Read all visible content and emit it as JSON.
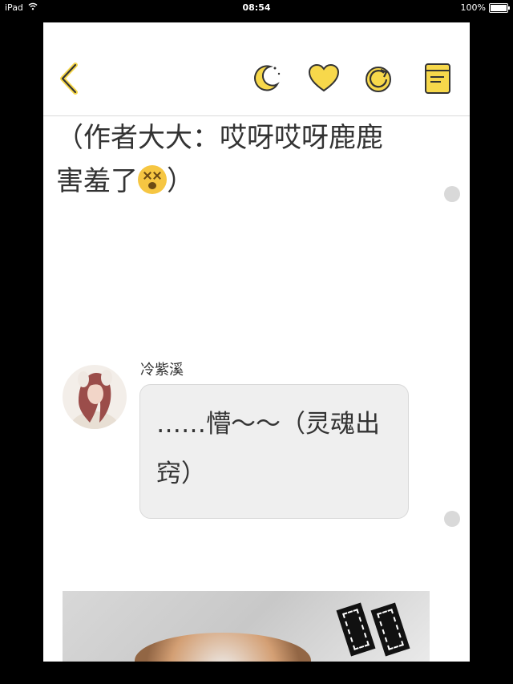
{
  "status_bar": {
    "device": "iPad",
    "time": "08:54",
    "battery": "100%"
  },
  "toolbar": {
    "back_icon": "chevron-left-icon",
    "night_mode_icon": "moon-icon",
    "favorite_icon": "heart-icon",
    "refresh_icon": "refresh-icon",
    "contents_icon": "book-icon",
    "accent_color": "#f7d84b"
  },
  "story": {
    "narration": "（作者大大：哎呀哎呀鹿鹿害羞了",
    "narration_end": "）",
    "emoji": "dizzy-face-emoji"
  },
  "message": {
    "username": "冷紫溪",
    "text": "……懵～～（灵魂出窍）",
    "bubble_color": "#efefef"
  }
}
